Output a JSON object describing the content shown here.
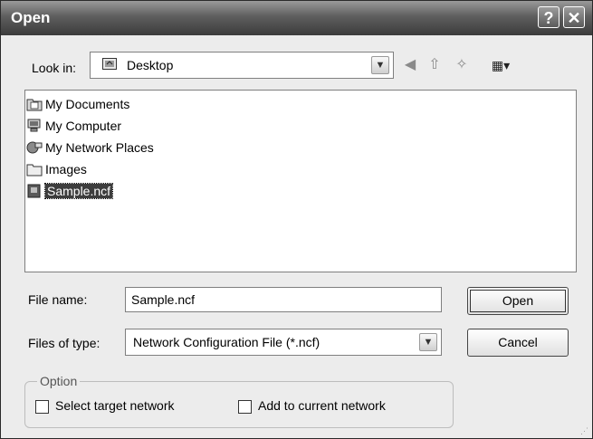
{
  "window": {
    "title": "Open",
    "help_glyph": "?",
    "close_glyph": "✕"
  },
  "toolbar": {
    "lookin_label": "Look in:",
    "lookin_value": "Desktop",
    "icons": [
      "back-icon",
      "up-folder-icon",
      "new-folder-icon",
      "views-menu-icon"
    ]
  },
  "files": [
    {
      "name": "My Documents",
      "icon": "documents-folder-icon"
    },
    {
      "name": "My Computer",
      "icon": "computer-icon"
    },
    {
      "name": "My Network Places",
      "icon": "network-places-icon"
    },
    {
      "name": "Images",
      "icon": "folder-icon"
    },
    {
      "name": "Sample.ncf",
      "icon": "ncf-file-icon",
      "selected": true
    }
  ],
  "form": {
    "filename_label": "File name:",
    "filename_value": "Sample.ncf",
    "filetype_label": "Files of type:",
    "filetype_value": "Network Configuration File (*.ncf)"
  },
  "buttons": {
    "open": "Open",
    "cancel": "Cancel"
  },
  "option": {
    "legend": "Option",
    "select_target": {
      "label": "Select target network",
      "checked": false
    },
    "add_current": {
      "label": "Add to current network",
      "checked": false
    }
  }
}
